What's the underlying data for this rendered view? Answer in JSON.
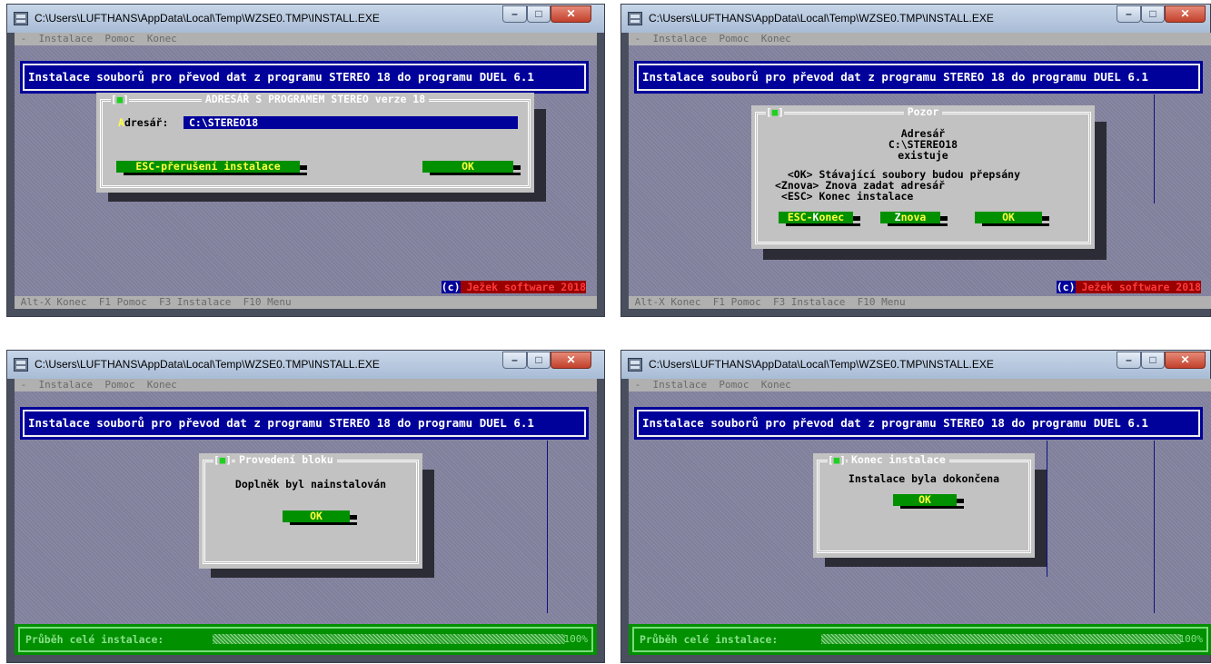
{
  "window": {
    "title": "C:\\Users\\LUFTHANS\\AppData\\Local\\Temp\\WZSE0.TMP\\INSTALL.EXE",
    "min_label": "–",
    "max_label": "□",
    "close_label": "✕",
    "icon": "console-app-icon"
  },
  "menubar": {
    "text": " -  Instalace  Pomoc  Konec"
  },
  "banner": {
    "text": "Instalace souborů pro převod dat z programu STEREO 18 do programu DUEL 6.1"
  },
  "statusbar": {
    "text": " Alt-X Konec  F1 Pomoc  F3 Instalace  F10 Menu"
  },
  "copyright": {
    "prefix": "(c)",
    "name": " Ježek software 2018"
  },
  "closebox": {
    "text": "[",
    "mark": "■",
    "end": "]"
  },
  "screen1": {
    "dialog_title": "ADRESÁŘ S PROGRAMEM STEREO verze 18",
    "field_label_hot": "A",
    "field_label_rest": "dresář:",
    "field_value": "C:\\STEREO18",
    "cancel_button": "ESC-přerušení instalace",
    "ok_button": "OK"
  },
  "screen2": {
    "dialog_title": "Pozor",
    "lines": [
      "Adresář",
      "C:\\STEREO18",
      "existuje"
    ],
    "options": [
      "  <OK> Stávající soubory budou přepsány",
      "<Znova> Znova zadat adresář",
      " <ESC> Konec instalace"
    ],
    "esc_button_hot": "ESC-",
    "esc_button_hotkey": "K",
    "esc_button_rest": "onec",
    "znova_hot": "Z",
    "znova_rest": "nova",
    "ok_button": "OK"
  },
  "screen3": {
    "dialog_title": "Provedení bloku",
    "message": "Doplněk byl nainstalován",
    "ok_button": "OK",
    "progress_label": "Průběh celé instalace:",
    "progress_percent": "100%",
    "progress_value": 1.0
  },
  "screen4": {
    "dialog_title": "Konec instalace",
    "message": "Instalace byla dokončena",
    "ok_button": "OK",
    "progress_label": "Průběh celé instalace:",
    "progress_percent": "100%",
    "progress_value": 1.0
  }
}
